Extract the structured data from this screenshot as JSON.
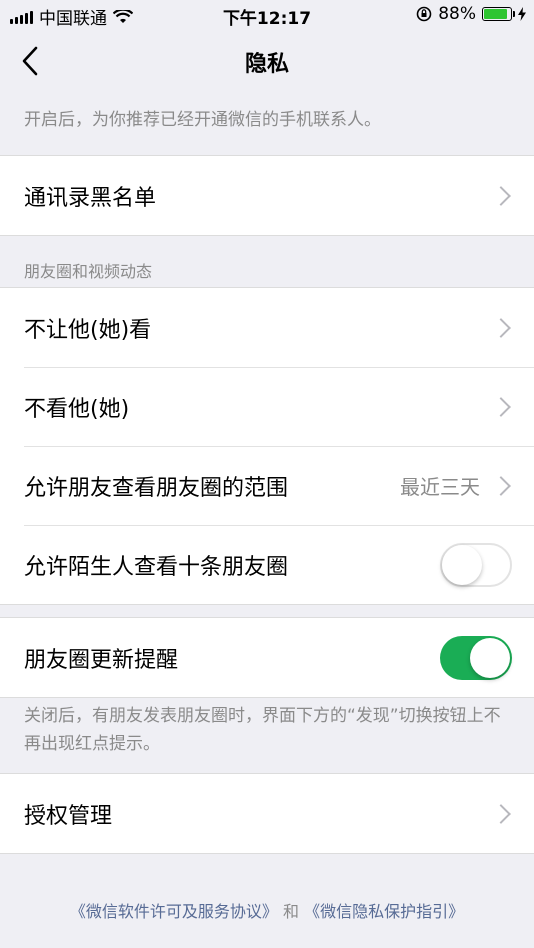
{
  "status_bar": {
    "carrier": "中国联通",
    "time": "下午12:17",
    "battery_percent": "88%",
    "battery_level": 0.88,
    "icons": [
      "signal-icon",
      "wifi-icon",
      "rotation-lock-icon",
      "battery-icon",
      "charging-icon"
    ]
  },
  "nav": {
    "title": "隐私",
    "back_icon": "chevron-left-icon"
  },
  "contacts_note": "开启后，为你推荐已经开通微信的手机联系人。",
  "blacklist": {
    "label": "通讯录黑名单"
  },
  "moments_section": {
    "header": "朋友圈和视频动态",
    "items": [
      {
        "label": "不让他(她)看"
      },
      {
        "label": "不看他(她)"
      },
      {
        "label": "允许朋友查看朋友圈的范围",
        "value": "最近三天"
      },
      {
        "label": "允许陌生人查看十条朋友圈",
        "toggle": false
      }
    ]
  },
  "moments_update": {
    "label": "朋友圈更新提醒",
    "toggle": true,
    "note": "关闭后，有朋友发表朋友圈时，界面下方的“发现”切换按钮上不再出现红点提示。"
  },
  "authorization": {
    "label": "授权管理"
  },
  "footer": {
    "link1": "《微信软件许可及服务协议》",
    "conjunction": "和",
    "link2": "《微信隐私保护指引》"
  },
  "colors": {
    "toggle_on": "#1aad55",
    "background": "#efeff4",
    "secondary_text": "#8a8a8a",
    "link": "#576b95"
  }
}
